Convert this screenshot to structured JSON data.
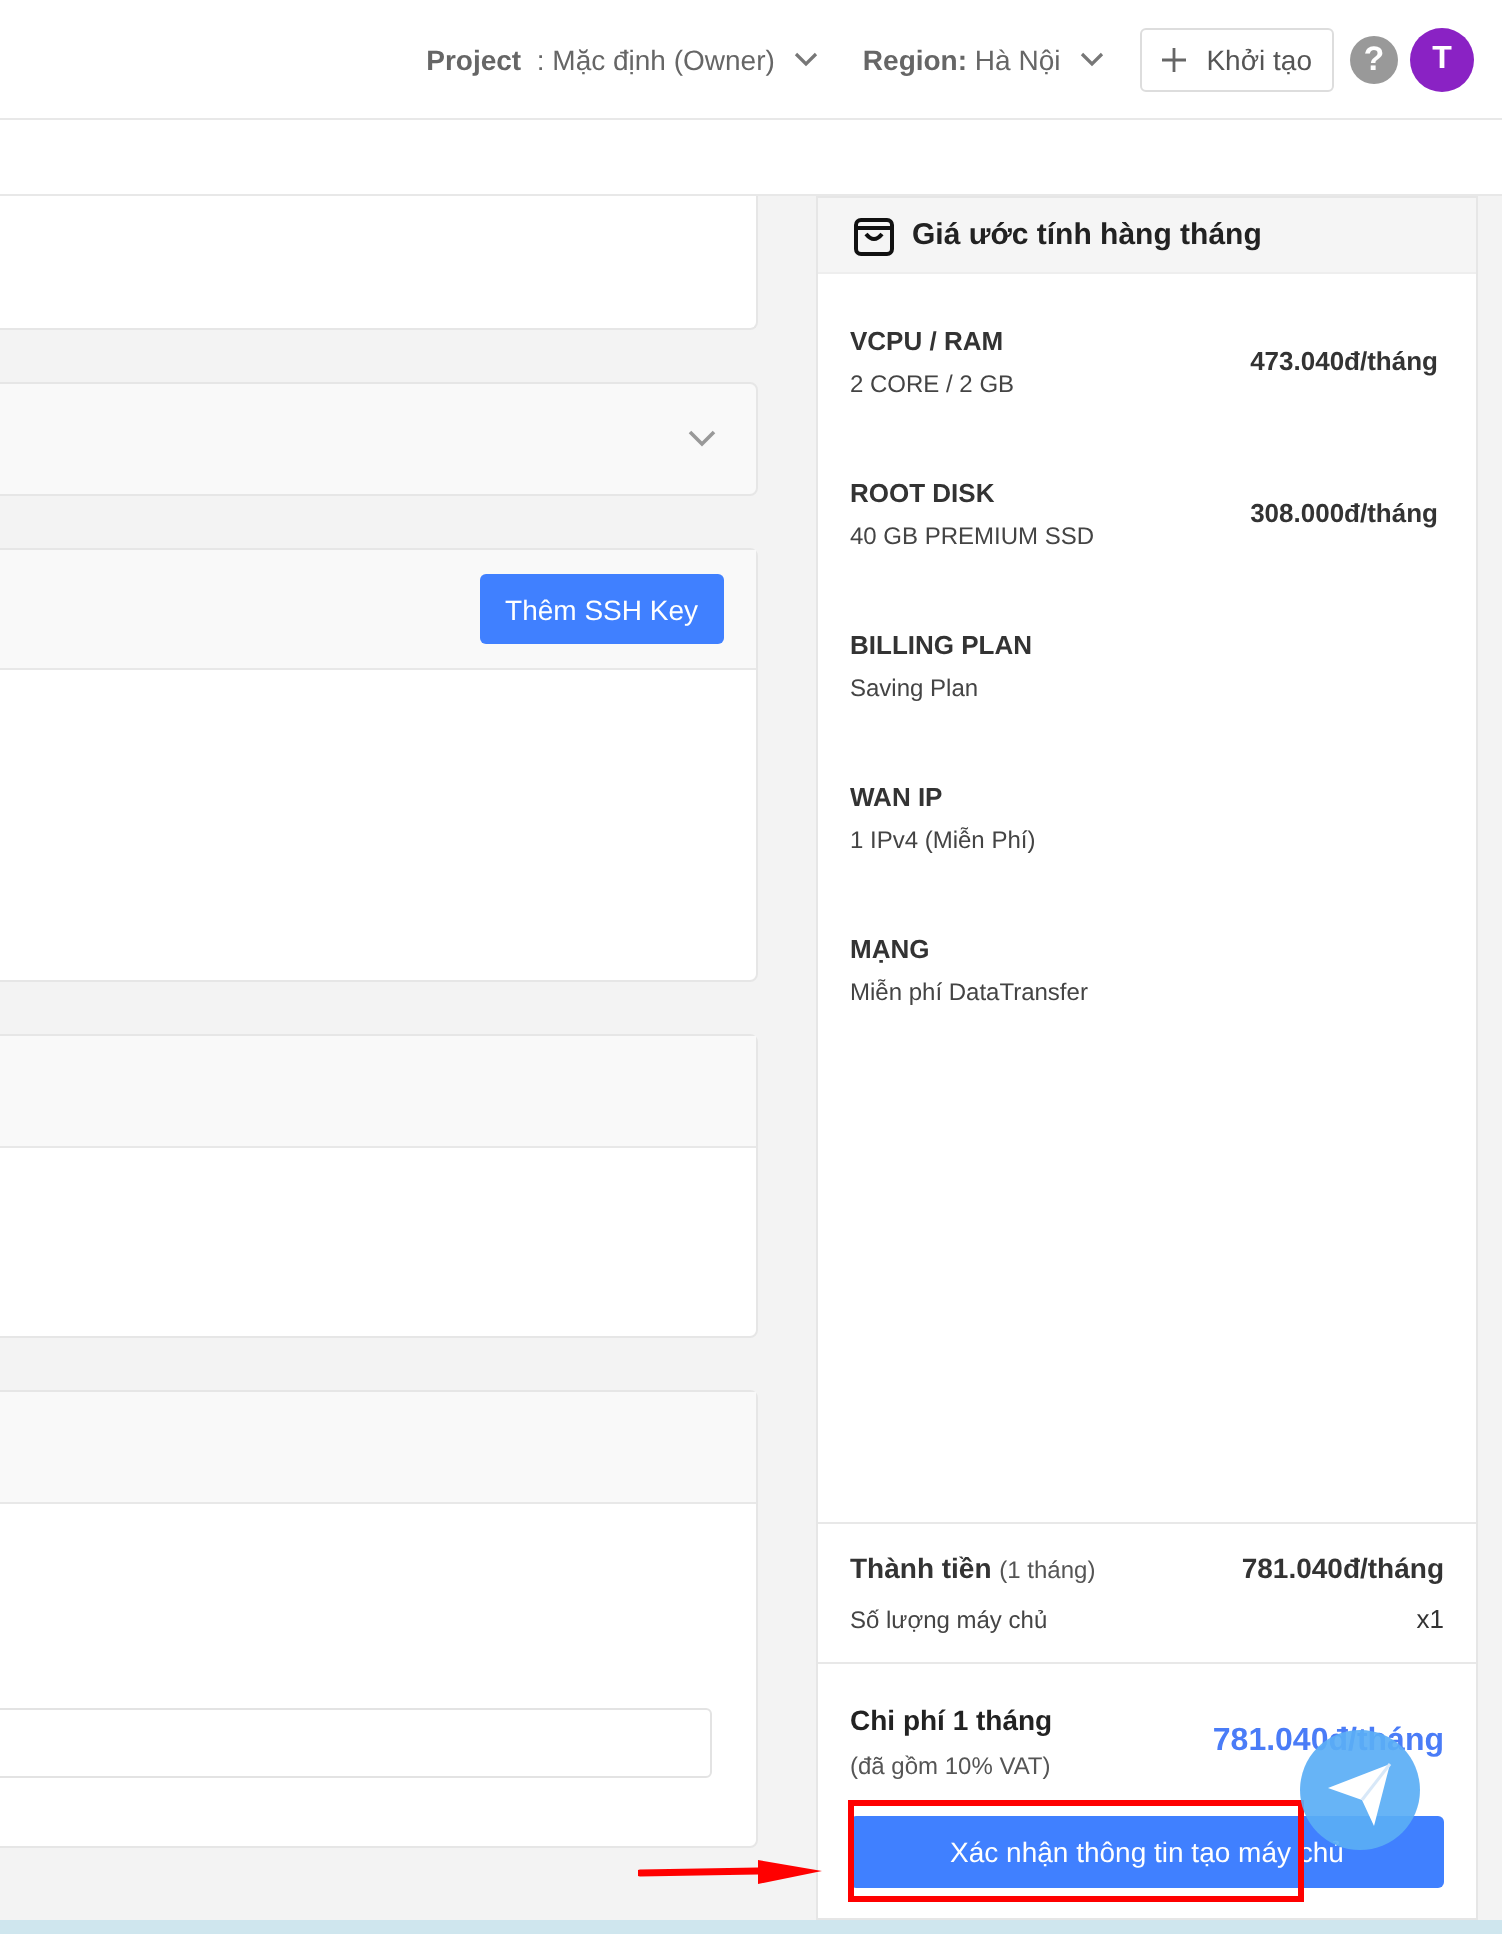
{
  "topbar": {
    "project": {
      "label": "Project",
      "value": " : Mặc định (Owner)"
    },
    "region": {
      "label": "Region:",
      "value": "Hà Nội"
    },
    "create_button": "Khởi tạo",
    "help": "?",
    "avatar": "T"
  },
  "cards": [
    {
      "kind": "body"
    },
    {
      "kind": "collapsed"
    },
    {
      "kind": "header_button",
      "button": "Thêm SSH Key"
    },
    {
      "kind": "header_body"
    },
    {
      "kind": "header_input"
    }
  ],
  "estimate": {
    "title": "Giá ước tính hàng tháng",
    "items": [
      {
        "label": "VCPU / RAM",
        "detail": "2 CORE / 2 GB",
        "price": "473.040đ/tháng"
      },
      {
        "label": "ROOT DISK",
        "detail": "40 GB PREMIUM SSD",
        "price": "308.000đ/tháng"
      },
      {
        "label": "BILLING PLAN",
        "detail": "Saving Plan"
      },
      {
        "label": "WAN IP",
        "detail": "1 IPv4 (Miễn Phí)"
      },
      {
        "label": "MẠNG",
        "detail": "Miễn phí DataTransfer"
      }
    ],
    "subtotal": {
      "label": "Thành tiền",
      "note": "(1 tháng)",
      "value": "781.040đ/tháng",
      "qty_label": "Số lượng máy chủ",
      "qty": "x1"
    },
    "total": {
      "label": "Chi phí 1 tháng",
      "note": "(đã gồm 10% VAT)",
      "value": "781.040đ/tháng"
    },
    "confirm_button": "Xác nhận thông tin tạo máy chủ"
  }
}
